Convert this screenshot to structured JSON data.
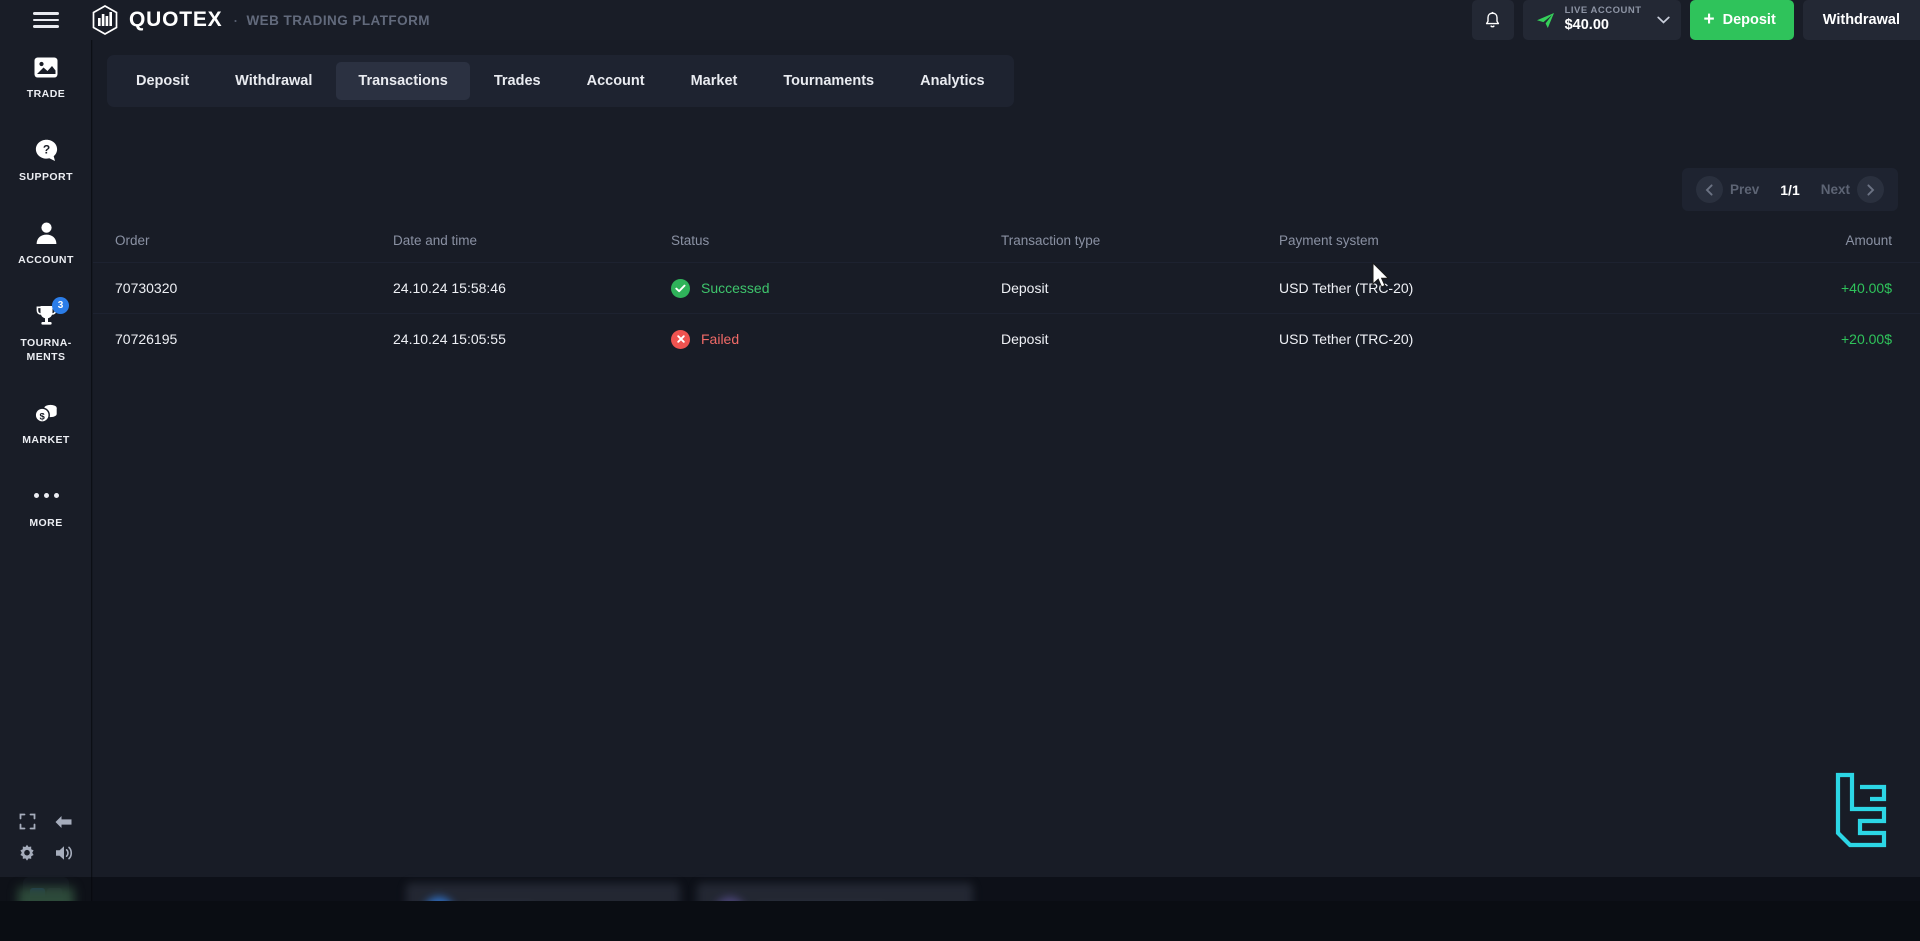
{
  "app": {
    "brand_name": "QUOTEX",
    "brand_separator": "·",
    "brand_subtitle": "WEB TRADING PLATFORM",
    "menu_icon": "hamburger-icon",
    "logo_icon": "quotex-logo-icon"
  },
  "header": {
    "notifications_icon": "bell-icon",
    "account_icon": "paper-plane-icon",
    "account_label": "LIVE ACCOUNT",
    "account_balance": "$40.00",
    "account_chevron_icon": "chevron-down-icon",
    "deposit_plus": "+",
    "deposit_label": "Deposit",
    "withdrawal_label": "Withdrawal"
  },
  "sidebar": {
    "items": [
      {
        "label": "TRADE",
        "icon": "chart-image-icon",
        "badge": ""
      },
      {
        "label": "SUPPORT",
        "icon": "question-chat-icon",
        "badge": ""
      },
      {
        "label": "ACCOUNT",
        "icon": "user-icon",
        "badge": ""
      },
      {
        "label": "TOURNA-\nMENTS",
        "label_line1": "TOURNA-",
        "label_line2": "MENTS",
        "icon": "trophy-icon",
        "badge": "3"
      },
      {
        "label": "MARKET",
        "icon": "coins-icon",
        "badge": ""
      },
      {
        "label": "MORE",
        "icon": "ellipsis-icon",
        "badge": ""
      }
    ],
    "bottom_icons": [
      {
        "name": "fullscreen-icon"
      },
      {
        "name": "back-arrow-icon"
      },
      {
        "name": "gear-icon"
      },
      {
        "name": "sound-icon"
      }
    ]
  },
  "tabs": [
    {
      "label": "Deposit",
      "active": false
    },
    {
      "label": "Withdrawal",
      "active": false
    },
    {
      "label": "Transactions",
      "active": true
    },
    {
      "label": "Trades",
      "active": false
    },
    {
      "label": "Account",
      "active": false
    },
    {
      "label": "Market",
      "active": false
    },
    {
      "label": "Tournaments",
      "active": false
    },
    {
      "label": "Analytics",
      "active": false
    }
  ],
  "pagination": {
    "prev_label": "Prev",
    "prev_icon": "chevron-left-icon",
    "page_indicator": "1/1",
    "next_label": "Next",
    "next_icon": "chevron-right-icon"
  },
  "table": {
    "columns": [
      "Order",
      "Date and time",
      "Status",
      "Transaction type",
      "Payment system",
      "Amount"
    ],
    "rows": [
      {
        "order": "70730320",
        "datetime": "24.10.24 15:58:46",
        "status": "Successed",
        "status_type": "success",
        "status_icon": "check-circle-icon",
        "transaction_type": "Deposit",
        "payment_system": "USD Tether (TRC-20)",
        "amount": "+40.00$"
      },
      {
        "order": "70726195",
        "datetime": "24.10.24 15:05:55",
        "status": "Failed",
        "status_type": "failed",
        "status_icon": "x-circle-icon",
        "transaction_type": "Deposit",
        "payment_system": "USD Tether (TRC-20)",
        "amount": "+20.00$"
      }
    ]
  },
  "watermark": {
    "icon": "lc-logo-watermark",
    "color": "#2ee0f0"
  },
  "colors": {
    "accent_green": "#2fc35b",
    "status_success": "#3ec46c",
    "status_failed": "#f06a67",
    "badge_blue": "#2b7de9",
    "panel_bg": "#181c26",
    "chrome_bg": "#191d27",
    "tab_active_bg": "#2b3141"
  }
}
